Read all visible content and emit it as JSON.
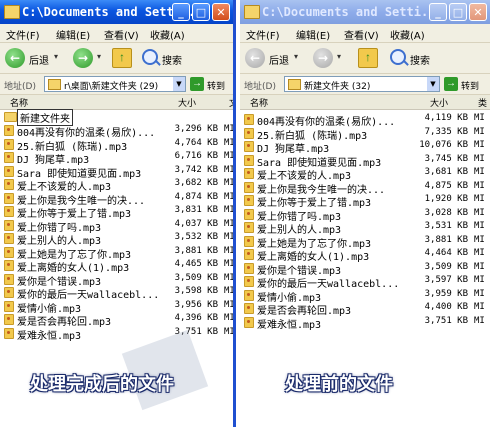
{
  "left_window": {
    "title": "C:\\Documents and Sett...",
    "menu": [
      "文件(F)",
      "编辑(E)",
      "查看(V)",
      "收藏(A)"
    ],
    "toolbar": {
      "back_label": "后退",
      "search_label": "搜索"
    },
    "address": {
      "label": "地址(D)",
      "path": "r\\桌面\\新建文件夹 (29)",
      "go_label": "转到"
    },
    "columns": {
      "name": "名称",
      "size": "大小",
      "type": "文"
    },
    "folder_row": "新建文件夹",
    "files": [
      {
        "name": "004再没有你的温柔(易欣)...",
        "size": "3,296 KB",
        "type": "MI"
      },
      {
        "name": "25.新白狐 (陈瑞).mp3",
        "size": "4,764 KB",
        "type": "MI"
      },
      {
        "name": "DJ 狗尾草.mp3",
        "size": "6,716 KB",
        "type": "MI"
      },
      {
        "name": "Sara 即使知道要见面.mp3",
        "size": "3,742 KB",
        "type": "MI"
      },
      {
        "name": "爱上不该爱的人.mp3",
        "size": "3,682 KB",
        "type": "MI"
      },
      {
        "name": "爱上你是我今生唯一的决...",
        "size": "4,874 KB",
        "type": "MI"
      },
      {
        "name": "爱上你等于爱上了错.mp3",
        "size": "3,831 KB",
        "type": "MI"
      },
      {
        "name": "爱上你错了吗.mp3",
        "size": "4,037 KB",
        "type": "MI"
      },
      {
        "name": "爱上别人的人.mp3",
        "size": "3,532 KB",
        "type": "MI"
      },
      {
        "name": "爱上她是为了忘了你.mp3",
        "size": "3,881 KB",
        "type": "MI"
      },
      {
        "name": "爱上离婚的女人(1).mp3",
        "size": "4,465 KB",
        "type": "MI"
      },
      {
        "name": "爱你是个错误.mp3",
        "size": "3,509 KB",
        "type": "MI"
      },
      {
        "name": "爱你的最后一天wallacebl...",
        "size": "3,598 KB",
        "type": "MI"
      },
      {
        "name": "爱情小偷.mp3",
        "size": "3,956 KB",
        "type": "MI"
      },
      {
        "name": "爱是否会再轮回.mp3",
        "size": "4,396 KB",
        "type": "MI"
      },
      {
        "name": "爱难永恒.mp3",
        "size": "3,751 KB",
        "type": "MI"
      }
    ],
    "caption": "处理完成后的文件"
  },
  "right_window": {
    "title": "C:\\Documents and Setti...",
    "menu": [
      "文件(F)",
      "编辑(E)",
      "查看(V)",
      "收藏(A)"
    ],
    "toolbar": {
      "back_label": "后退",
      "search_label": "搜索"
    },
    "address": {
      "label": "地址(D)",
      "path": "新建文件夹 (32)",
      "go_label": "转到"
    },
    "columns": {
      "name": "名称",
      "size": "大小",
      "type": "类"
    },
    "files": [
      {
        "name": "004再没有你的温柔(易欣)...",
        "size": "4,119 KB",
        "type": "MI"
      },
      {
        "name": "25.新白狐 (陈瑞).mp3",
        "size": "7,335 KB",
        "type": "MI"
      },
      {
        "name": "DJ 狗尾草.mp3",
        "size": "10,076 KB",
        "type": "MI"
      },
      {
        "name": "Sara 即使知道要见面.mp3",
        "size": "3,745 KB",
        "type": "MI"
      },
      {
        "name": "爱上不该爱的人.mp3",
        "size": "3,681 KB",
        "type": "MI"
      },
      {
        "name": "爱上你是我今生唯一的决...",
        "size": "4,875 KB",
        "type": "MI"
      },
      {
        "name": "爱上你等于爱上了错.mp3",
        "size": "1,920 KB",
        "type": "MI"
      },
      {
        "name": "爱上你错了吗.mp3",
        "size": "3,028 KB",
        "type": "MI"
      },
      {
        "name": "爱上别人的人.mp3",
        "size": "3,531 KB",
        "type": "MI"
      },
      {
        "name": "爱上她是为了忘了你.mp3",
        "size": "3,881 KB",
        "type": "MI"
      },
      {
        "name": "爱上离婚的女人(1).mp3",
        "size": "4,464 KB",
        "type": "MI"
      },
      {
        "name": "爱你是个错误.mp3",
        "size": "3,509 KB",
        "type": "MI"
      },
      {
        "name": "爱你的最后一天wallacebl...",
        "size": "3,597 KB",
        "type": "MI"
      },
      {
        "name": "爱情小偷.mp3",
        "size": "3,959 KB",
        "type": "MI"
      },
      {
        "name": "爱是否会再轮回.mp3",
        "size": "4,400 KB",
        "type": "MI"
      },
      {
        "name": "爱难永恒.mp3",
        "size": "3,751 KB",
        "type": "MI"
      }
    ],
    "caption": "处理前的文件"
  }
}
